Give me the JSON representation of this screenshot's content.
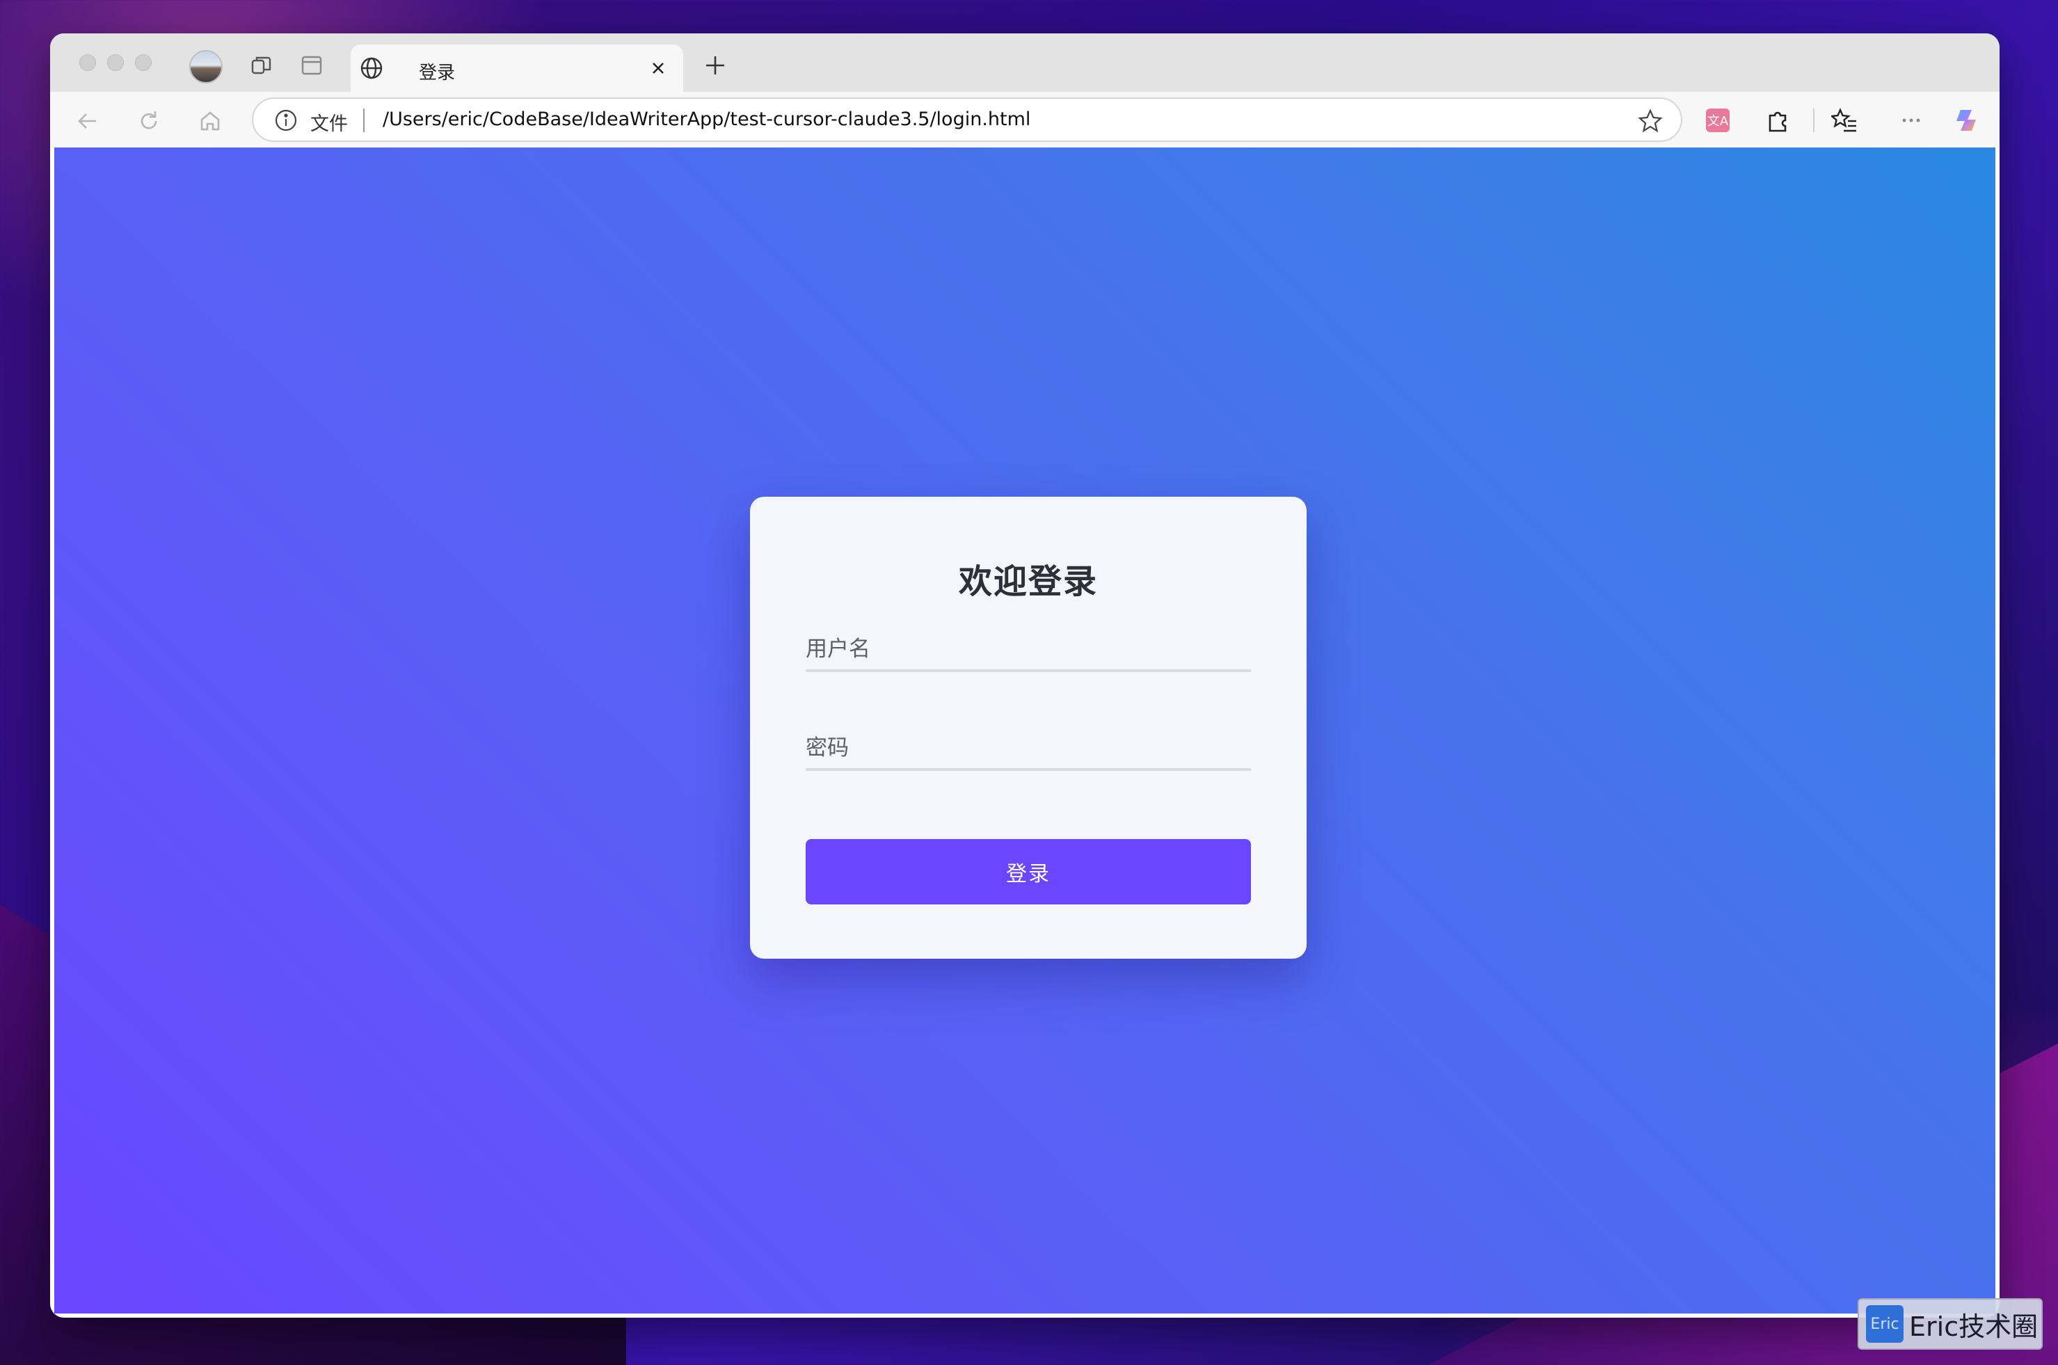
{
  "browser": {
    "tab": {
      "title": "登录"
    },
    "address_bar": {
      "scheme_label": "文件",
      "url": "/Users/eric/CodeBase/IdeaWriterApp/test-cursor-claude3.5/login.html"
    }
  },
  "login": {
    "title": "欢迎登录",
    "username_placeholder": "用户名",
    "password_placeholder": "密码",
    "submit_label": "登录"
  },
  "watermark": {
    "logo_text": "Eric",
    "text": "Eric技术圈"
  },
  "colors": {
    "accent": "#6a46ff",
    "gradient_start": "#6a46ff",
    "gradient_end": "#2a88e2",
    "card_background": "#f4f6fc"
  }
}
